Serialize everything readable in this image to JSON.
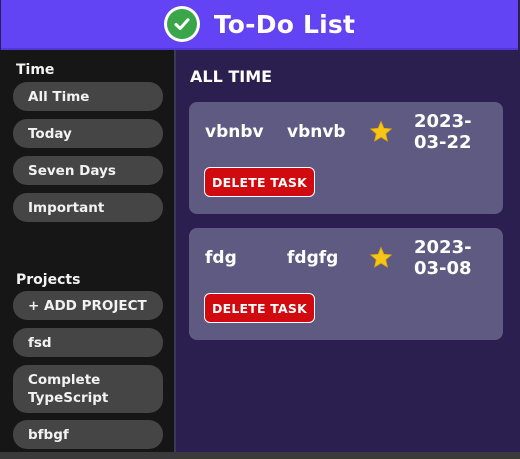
{
  "header": {
    "title": "To-Do List",
    "icon": "check-circle-icon",
    "background": "#6344f5"
  },
  "sidebar": {
    "time_heading": "Time",
    "time_items": [
      {
        "label": "All Time"
      },
      {
        "label": "Today"
      },
      {
        "label": "Seven Days"
      },
      {
        "label": "Important"
      }
    ],
    "projects_heading": "Projects",
    "add_project_label": "+ ADD PROJECT",
    "projects": [
      {
        "label": "fsd"
      },
      {
        "label": "Complete TypeScript"
      },
      {
        "label": "bfbgf"
      }
    ]
  },
  "main": {
    "title": "ALL TIME",
    "tasks": [
      {
        "name": "vbnbv",
        "description": "vbnvb",
        "date": "2023-03-22",
        "important": true,
        "delete_label": "DELETE TASK"
      },
      {
        "name": "fdg",
        "description": "fdgfg",
        "date": "2023-03-08",
        "important": true,
        "delete_label": "DELETE TASK"
      }
    ]
  },
  "colors": {
    "main_bg": "#2a1f4e",
    "card_bg": "#5f5a82",
    "sidebar_bg": "#161616",
    "pill_bg": "#454545",
    "delete_bg": "#d10a0f",
    "star": "#f5c518"
  }
}
